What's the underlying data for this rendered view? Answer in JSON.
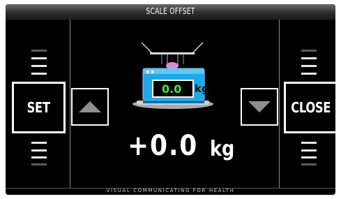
{
  "title": "SCALE  OFFSET",
  "footer": "VISUAL  COMMUNICATING  FOR  HEALTH",
  "buttons": {
    "set": "SET",
    "close": "CLOSE"
  },
  "icons": {
    "increase": "triangle-up-icon",
    "decrease": "triangle-down-icon",
    "scale": "weighing-scale-icon"
  },
  "scale_icon": {
    "display_value": "0.0",
    "display_unit": "kg"
  },
  "offset": {
    "value": "+0.0",
    "unit": "kg"
  },
  "colors": {
    "background": "#000000",
    "scale_body": "#1fa8e8",
    "display_digits": "#43e843"
  }
}
